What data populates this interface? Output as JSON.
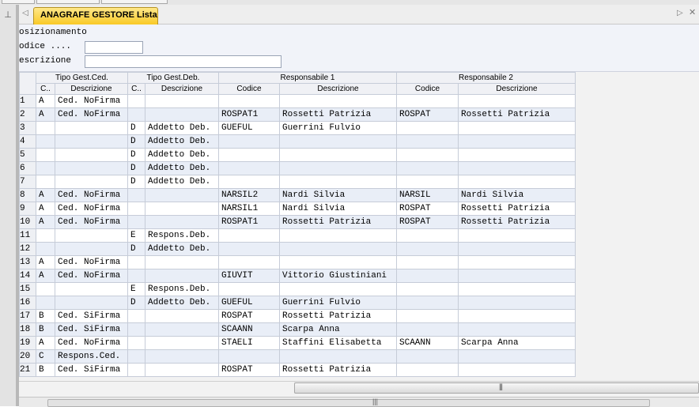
{
  "tab": {
    "title": "ANAGRAFE GESTORE  Lista"
  },
  "filters": {
    "posizionamento": "osizionamento",
    "codice": "odice ....",
    "descrizione": "escrizione"
  },
  "grid": {
    "groups": [
      "Tipo Gest.Ced.",
      "Tipo Gest.Deb.",
      "Responsabile 1",
      "Responsabile 2"
    ],
    "columns": [
      "C..",
      "Descrizione",
      "C..",
      "Descrizione",
      "Codice",
      "Descrizione",
      "Codice",
      "Descrizione"
    ],
    "rows": [
      {
        "n": "1",
        "c1": "A",
        "d1": "Ced. NoFirma",
        "c2": "",
        "d2": "",
        "r1c": "",
        "r1d": "",
        "r2c": "",
        "r2d": ""
      },
      {
        "n": "2",
        "c1": "A",
        "d1": "Ced. NoFirma",
        "c2": "",
        "d2": "",
        "r1c": "ROSPAT1",
        "r1d": "Rossetti Patrizia",
        "r2c": "ROSPAT",
        "r2d": "Rossetti Patrizia"
      },
      {
        "n": "3",
        "c1": "",
        "d1": "",
        "c2": "D",
        "d2": "Addetto Deb.",
        "r1c": "GUEFUL",
        "r1d": "Guerrini Fulvio",
        "r2c": "",
        "r2d": ""
      },
      {
        "n": "4",
        "c1": "",
        "d1": "",
        "c2": "D",
        "d2": "Addetto Deb.",
        "r1c": "",
        "r1d": "",
        "r2c": "",
        "r2d": ""
      },
      {
        "n": "5",
        "c1": "",
        "d1": "",
        "c2": "D",
        "d2": "Addetto Deb.",
        "r1c": "",
        "r1d": "",
        "r2c": "",
        "r2d": ""
      },
      {
        "n": "6",
        "c1": "",
        "d1": "",
        "c2": "D",
        "d2": "Addetto Deb.",
        "r1c": "",
        "r1d": "",
        "r2c": "",
        "r2d": ""
      },
      {
        "n": "7",
        "c1": "",
        "d1": "",
        "c2": "D",
        "d2": "Addetto Deb.",
        "r1c": "",
        "r1d": "",
        "r2c": "",
        "r2d": ""
      },
      {
        "n": "8",
        "c1": "A",
        "d1": "Ced. NoFirma",
        "c2": "",
        "d2": "",
        "r1c": "NARSIL2",
        "r1d": "Nardi Silvia",
        "r2c": "NARSIL",
        "r2d": "Nardi Silvia"
      },
      {
        "n": "9",
        "c1": "A",
        "d1": "Ced. NoFirma",
        "c2": "",
        "d2": "",
        "r1c": "NARSIL1",
        "r1d": "Nardi Silvia",
        "r2c": "ROSPAT",
        "r2d": "Rossetti Patrizia"
      },
      {
        "n": "10",
        "c1": "A",
        "d1": "Ced. NoFirma",
        "c2": "",
        "d2": "",
        "r1c": "ROSPAT1",
        "r1d": "Rossetti Patrizia",
        "r2c": "ROSPAT",
        "r2d": "Rossetti Patrizia"
      },
      {
        "n": "11",
        "c1": "",
        "d1": "",
        "c2": "E",
        "d2": "Respons.Deb.",
        "r1c": "",
        "r1d": "",
        "r2c": "",
        "r2d": ""
      },
      {
        "n": "12",
        "c1": "",
        "d1": "",
        "c2": "D",
        "d2": "Addetto Deb.",
        "r1c": "",
        "r1d": "",
        "r2c": "",
        "r2d": ""
      },
      {
        "n": "13",
        "c1": "A",
        "d1": "Ced. NoFirma",
        "c2": "",
        "d2": "",
        "r1c": "",
        "r1d": "",
        "r2c": "",
        "r2d": ""
      },
      {
        "n": "14",
        "c1": "A",
        "d1": "Ced. NoFirma",
        "c2": "",
        "d2": "",
        "r1c": "GIUVIT",
        "r1d": "Vittorio Giustiniani",
        "r2c": "",
        "r2d": ""
      },
      {
        "n": "15",
        "c1": "",
        "d1": "",
        "c2": "E",
        "d2": "Respons.Deb.",
        "r1c": "",
        "r1d": "",
        "r2c": "",
        "r2d": ""
      },
      {
        "n": "16",
        "c1": "",
        "d1": "",
        "c2": "D",
        "d2": "Addetto Deb.",
        "r1c": "GUEFUL",
        "r1d": "Guerrini Fulvio",
        "r2c": "",
        "r2d": ""
      },
      {
        "n": "17",
        "c1": "B",
        "d1": "Ced. SiFirma",
        "c2": "",
        "d2": "",
        "r1c": "ROSPAT",
        "r1d": "Rossetti Patrizia",
        "r2c": "",
        "r2d": ""
      },
      {
        "n": "18",
        "c1": "B",
        "d1": "Ced. SiFirma",
        "c2": "",
        "d2": "",
        "r1c": "SCAANN",
        "r1d": "Scarpa Anna",
        "r2c": "",
        "r2d": ""
      },
      {
        "n": "19",
        "c1": "A",
        "d1": "Ced. NoFirma",
        "c2": "",
        "d2": "",
        "r1c": "STAELI",
        "r1d": "Staffini Elisabetta",
        "r2c": "SCAANN",
        "r2d": "Scarpa Anna"
      },
      {
        "n": "20",
        "c1": "C",
        "d1": "Respons.Ced.",
        "c2": "",
        "d2": "",
        "r1c": "",
        "r1d": "",
        "r2c": "",
        "r2d": ""
      },
      {
        "n": "21",
        "c1": "B",
        "d1": "Ced. SiFirma",
        "c2": "",
        "d2": "",
        "r1c": "ROSPAT",
        "r1d": "Rossetti Patrizia",
        "r2c": "",
        "r2d": ""
      }
    ]
  },
  "icons": {
    "pin": "pin-icon",
    "left": "arrow-left-icon",
    "right": "arrow-right-icon",
    "close": "close-icon"
  }
}
